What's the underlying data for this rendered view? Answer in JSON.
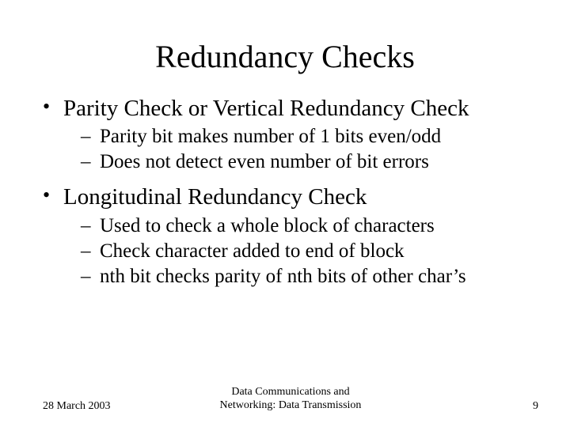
{
  "title": "Redundancy Checks",
  "bullets": [
    {
      "text": "Parity Check or Vertical Redundancy Check",
      "sub": [
        "Parity bit makes number of 1 bits even/odd",
        "Does not detect even number of bit errors"
      ]
    },
    {
      "text": "Longitudinal Redundancy Check",
      "sub": [
        "Used to check a whole block of characters",
        "Check character added to end of block",
        "nth bit checks parity of nth bits of other char’s"
      ]
    }
  ],
  "footer": {
    "date": "28 March 2003",
    "center_line1": "Data Communications and",
    "center_line2": "Networking: Data Transmission",
    "page": "9"
  }
}
